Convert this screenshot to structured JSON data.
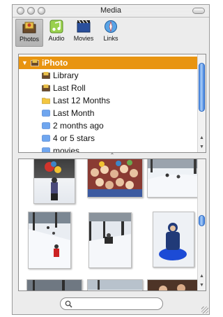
{
  "window": {
    "title": "Media"
  },
  "toolbar": {
    "items": [
      {
        "label": "Photos",
        "icon": "photos-icon",
        "selected": true
      },
      {
        "label": "Audio",
        "icon": "audio-icon",
        "selected": false
      },
      {
        "label": "Movies",
        "icon": "movies-icon",
        "selected": false
      },
      {
        "label": "Links",
        "icon": "links-icon",
        "selected": false
      }
    ]
  },
  "source_list": {
    "items": [
      {
        "label": "iPhoto",
        "icon": "iphoto-icon",
        "selected": true,
        "expanded": true
      },
      {
        "label": "Library",
        "icon": "library-icon"
      },
      {
        "label": "Last Roll",
        "icon": "last-roll-icon"
      },
      {
        "label": "Last 12 Months",
        "icon": "folder-icon"
      },
      {
        "label": "Last Month",
        "icon": "album-icon"
      },
      {
        "label": "2 months ago",
        "icon": "album-icon"
      },
      {
        "label": "4 or 5 stars",
        "icon": "album-icon"
      },
      {
        "label": "movies",
        "icon": "album-icon"
      }
    ]
  },
  "photos": [
    {
      "subject": "child in snow gear"
    },
    {
      "subject": "crowd of children"
    },
    {
      "subject": "snowy hillside"
    },
    {
      "subject": "sledder on hill"
    },
    {
      "subject": "sledder in woods"
    },
    {
      "subject": "child on blue sled"
    },
    {
      "subject": "snowy trees"
    },
    {
      "subject": "snow scene"
    },
    {
      "subject": "people indoors"
    }
  ],
  "search": {
    "placeholder": ""
  },
  "colors": {
    "selection": "#e89411",
    "scroll_thumb": "#4f8fe8"
  }
}
